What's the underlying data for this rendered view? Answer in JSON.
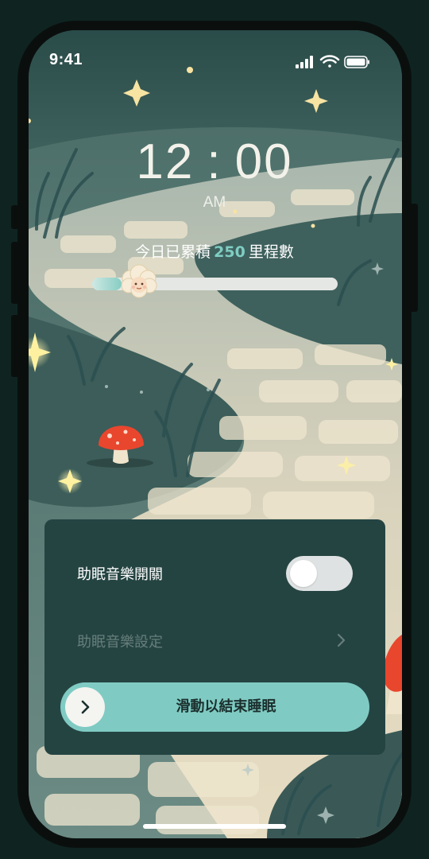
{
  "status_bar": {
    "time": "9:41",
    "icons": [
      "cellular-signal-icon",
      "wifi-icon",
      "battery-icon"
    ]
  },
  "clock": {
    "hours": "12",
    "separator": ":",
    "minutes": "00",
    "period": "AM"
  },
  "mileage": {
    "prefix": "今日已累積",
    "value": "250",
    "suffix": "里程數",
    "progress_fraction": 0.12
  },
  "panel": {
    "music_toggle_label": "助眠音樂開關",
    "music_toggle_on": false,
    "music_settings_label": "助眠音樂設定",
    "slide_to_end_label": "滑動以結束睡眠"
  },
  "colors": {
    "accent": "#7fcbc3",
    "panel": "#244442",
    "mileage_value": "#7fcdc3"
  }
}
